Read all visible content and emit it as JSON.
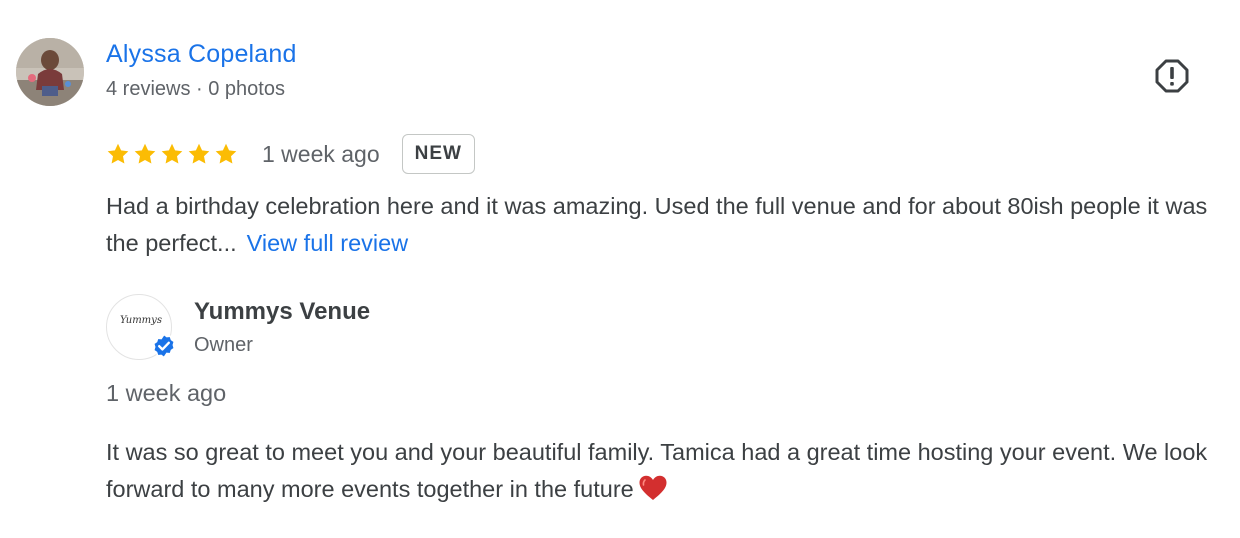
{
  "reviewer": {
    "name": "Alyssa Copeland",
    "meta": "4 reviews · 0 photos"
  },
  "review": {
    "rating": 5,
    "rating_max": 5,
    "date": "1 week ago",
    "badge": "NEW",
    "text": "Had a birthday celebration here and it was amazing. Used the full venue and for about 80ish people it was the perfect...",
    "view_full_label": "View full review"
  },
  "owner_response": {
    "name": "Yummys Venue",
    "role": "Owner",
    "logo_text": "Yummys",
    "date": "1 week ago",
    "text": "It was so great to meet you and your beautiful family. Tamica had a great time hosting your event. We look forward to many more events together in the future",
    "emoji": "heart"
  },
  "icons": {
    "report": "report-icon",
    "star": "star-icon",
    "verified": "verified-check-icon",
    "heart": "red-heart-icon"
  },
  "colors": {
    "link": "#1a73e8",
    "star": "#fbbc04",
    "text": "#3c4043",
    "secondary_text": "#5f6368",
    "verified": "#1a73e8",
    "heart": "#d32f2f"
  }
}
